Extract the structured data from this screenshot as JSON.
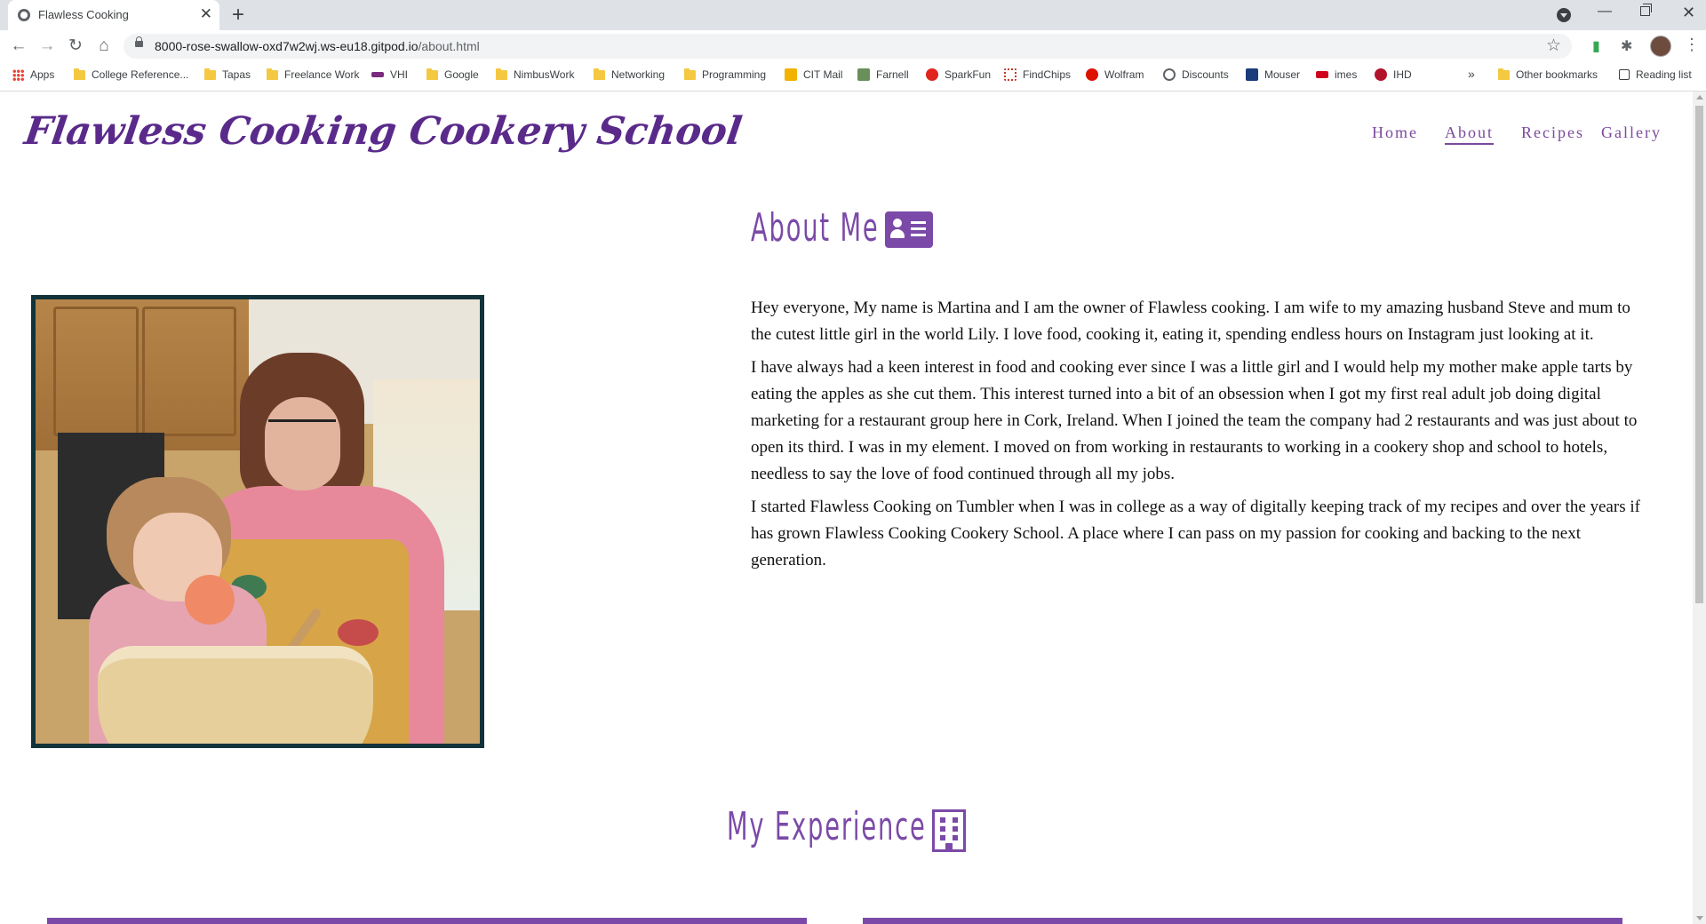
{
  "browser": {
    "tab_title": "Flawless Cooking",
    "url_host": "8000-rose-swallow-oxd7w2wj.ws-eu18.gitpod.io",
    "url_path": "/about.html",
    "bookmarks": [
      {
        "label": "Apps",
        "icon": "apps-grid-icon"
      },
      {
        "label": "College Reference...",
        "icon": "folder-icon"
      },
      {
        "label": "Tapas",
        "icon": "folder-icon"
      },
      {
        "label": "Freelance Work",
        "icon": "folder-icon"
      },
      {
        "label": "VHI",
        "icon": "vhi-icon"
      },
      {
        "label": "Google",
        "icon": "folder-icon"
      },
      {
        "label": "NimbusWork",
        "icon": "folder-icon"
      },
      {
        "label": "Networking",
        "icon": "folder-icon"
      },
      {
        "label": "Programming",
        "icon": "folder-icon"
      },
      {
        "label": "CIT Mail",
        "icon": "cit-mail-icon"
      },
      {
        "label": "Farnell",
        "icon": "farnell-icon"
      },
      {
        "label": "SparkFun",
        "icon": "sparkfun-icon"
      },
      {
        "label": "FindChips",
        "icon": "findchips-icon"
      },
      {
        "label": "Wolfram",
        "icon": "wolfram-icon"
      },
      {
        "label": "Discounts",
        "icon": "globe-icon"
      },
      {
        "label": "Mouser",
        "icon": "mouser-icon"
      },
      {
        "label": "imes",
        "icon": "eet-icon"
      },
      {
        "label": "IHD",
        "icon": "ihd-icon"
      }
    ],
    "overflow_label": "»",
    "other_bookmarks": "Other bookmarks",
    "reading_list": "Reading list"
  },
  "site": {
    "title": "Flawless Cooking Cookery School",
    "nav": [
      "Home",
      "About",
      "Recipes",
      "Gallery"
    ],
    "active_nav": "About"
  },
  "about": {
    "heading": "About Me",
    "paragraphs": [
      "Hey everyone, My name is Martina and I am the owner of Flawless cooking. I am wife to my amazing husband Steve and mum to the cutest little girl in the world Lily. I love food, cooking it, eating it, spending endless hours on Instagram just looking at it.",
      "I have always had a keen interest in food and cooking ever since I was a little girl and I would help my mother make apple tarts by eating the apples as she cut them. This interest turned into a bit of an obsession when I got my first real adult job doing digital marketing for a restaurant group here in Cork, Ireland. When I joined the team the company had 2 restaurants and was just about to open its third. I was in my element. I moved on from working in restaurants to working in a cookery shop and school to hotels, needless to say the love of food continued through all my jobs.",
      "I started Flawless Cooking on Tumbler when I was in college as a way of digitally keeping track of my recipes and over the years if has grown Flawless Cooking Cookery School. A place where I can pass on my passion for cooking and backing to the next generation."
    ]
  },
  "experience": {
    "heading": "My Experience"
  },
  "colors": {
    "accent": "#7b4aa8",
    "title": "#5a2a8a",
    "frame": "#12333a"
  }
}
